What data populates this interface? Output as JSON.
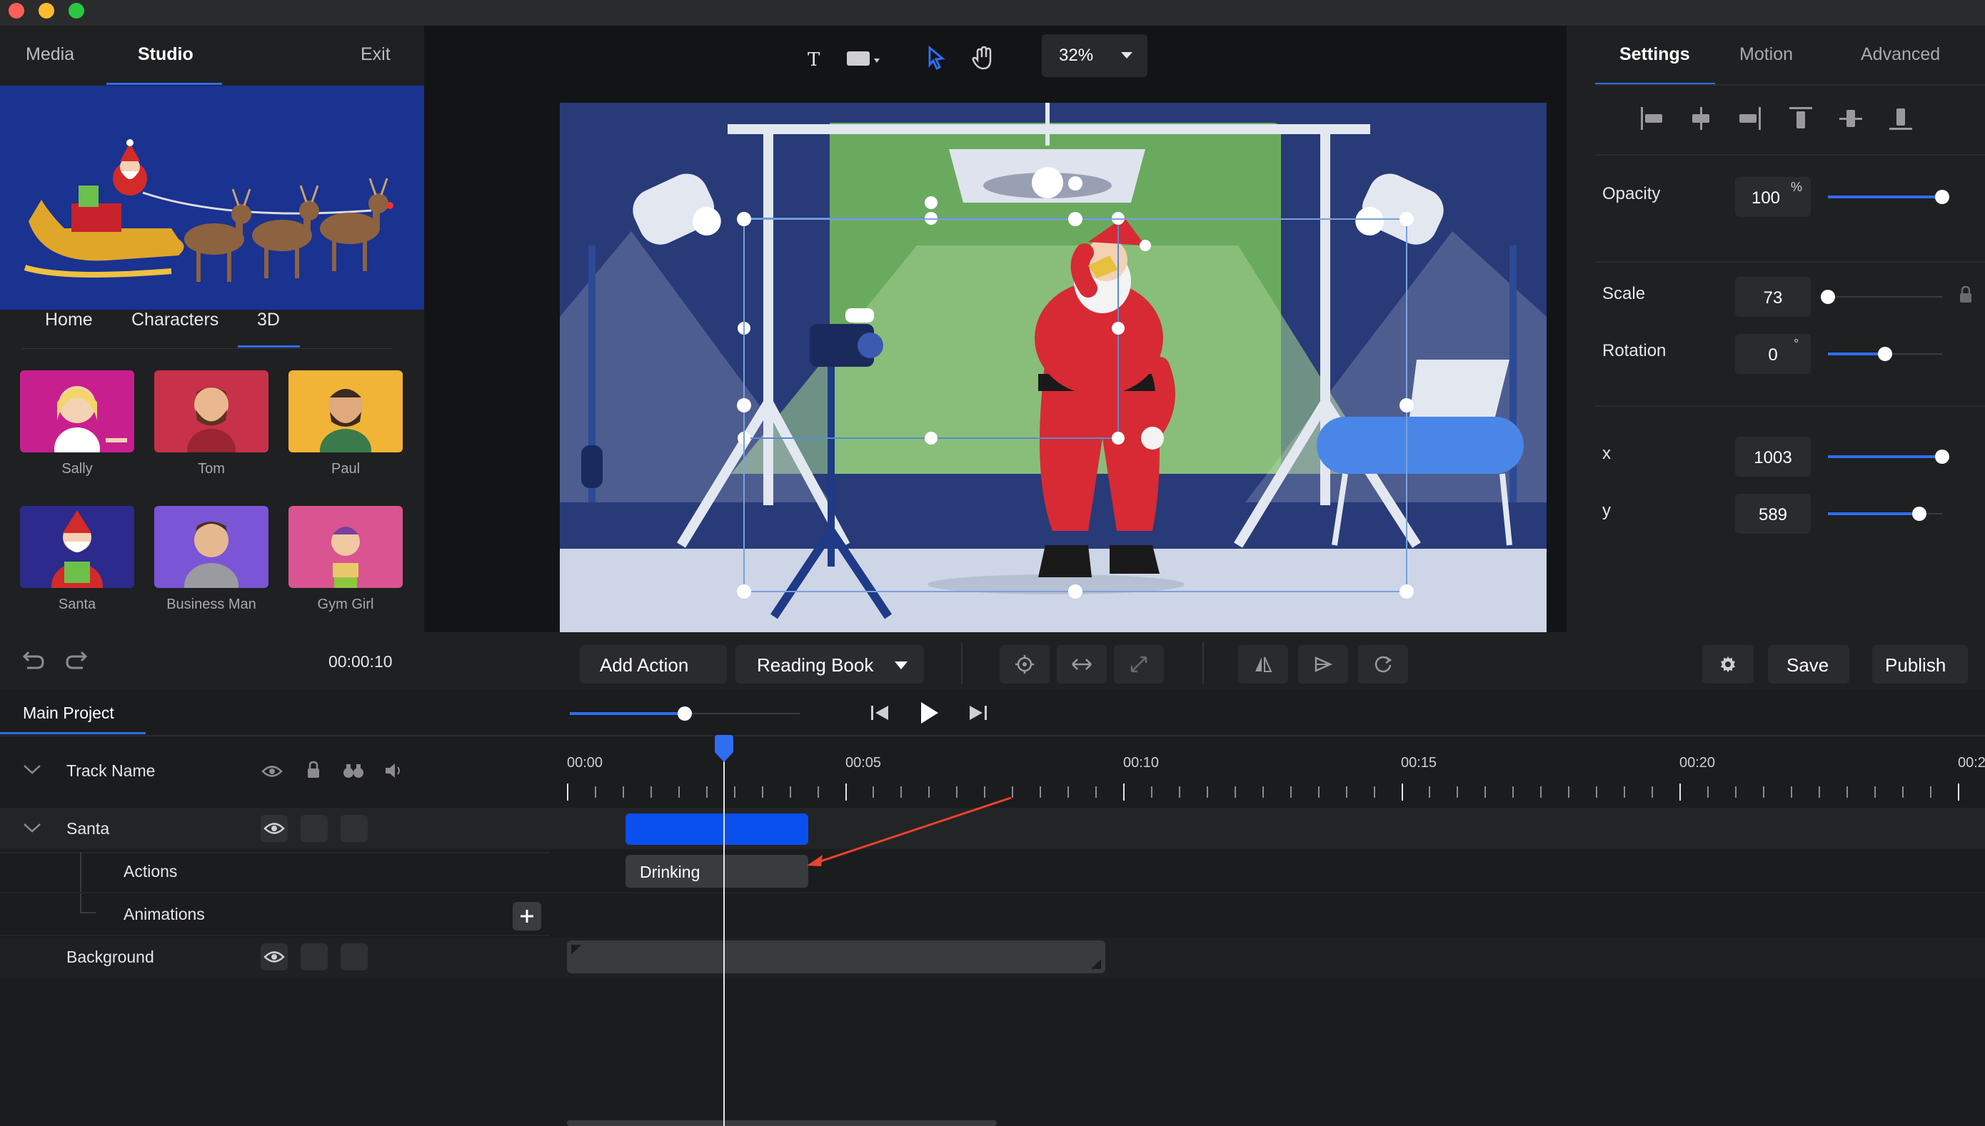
{
  "left_tabs": {
    "media": "Media",
    "studio": "Studio",
    "exit": "Exit"
  },
  "category_tabs": {
    "home": "Home",
    "characters": "Characters",
    "three_d": "3D"
  },
  "characters": [
    {
      "name": "Sally",
      "color": "#c81f8f"
    },
    {
      "name": "Tom",
      "color": "#c8314a"
    },
    {
      "name": "Paul",
      "color": "#f2b436"
    },
    {
      "name": "Santa",
      "color": "#2c2a8c"
    },
    {
      "name": "Business Man",
      "color": "#7a55d6"
    },
    {
      "name": "Gym Girl",
      "color": "#d95490"
    }
  ],
  "history": {
    "time": "00:00:10"
  },
  "toolbar": {
    "zoom": "32%"
  },
  "right_tabs": {
    "settings": "Settings",
    "motion": "Motion",
    "advanced": "Advanced"
  },
  "properties": {
    "opacity": {
      "label": "Opacity",
      "value": "100",
      "unit": "%",
      "level": 1.0
    },
    "scale": {
      "label": "Scale",
      "value": "73",
      "level": 0.0
    },
    "rotation": {
      "label": "Rotation",
      "value": "0",
      "unit": "°",
      "level": 0.5
    },
    "x": {
      "label": "x",
      "value": "1003",
      "level": 1.0
    },
    "y": {
      "label": "y",
      "value": "589",
      "level": 0.8
    }
  },
  "actionbar": {
    "add_action": "Add Action",
    "preset": "Reading Book",
    "save": "Save",
    "publish": "Publish"
  },
  "timeline": {
    "project_tab": "Main Project",
    "track_header": "Track Name",
    "tracks": {
      "santa": "Santa",
      "actions": "Actions",
      "animations": "Animations",
      "background": "Background"
    },
    "clip_label": "Drinking",
    "ticks": [
      "00:00",
      "00:05",
      "00:10",
      "00:15",
      "00:20",
      "00:2"
    ],
    "volume_level": 0.5
  },
  "colors": {
    "accent": "#2f6df3",
    "clip": "#0a4ff0",
    "arrow": "#e8432f"
  }
}
